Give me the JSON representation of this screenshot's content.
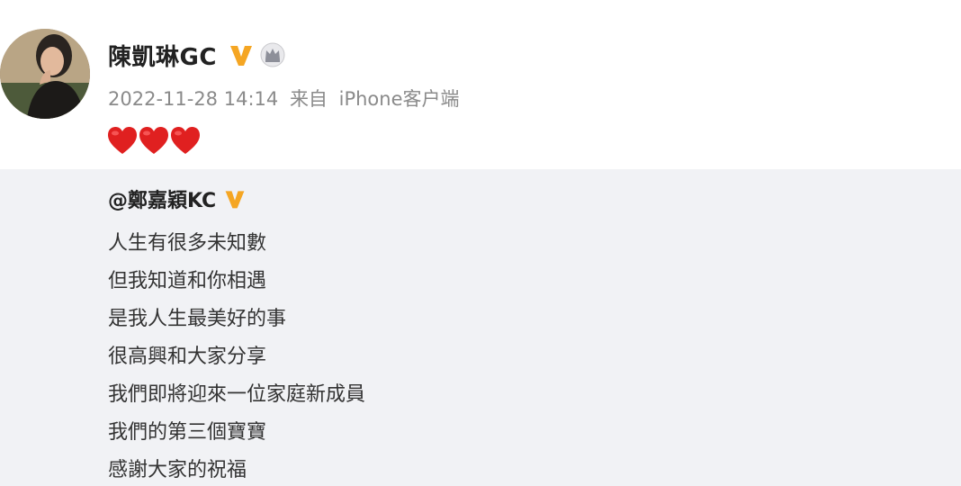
{
  "post": {
    "author": {
      "name": "陳凱琳GC",
      "verified_icon": "v-verified-badge",
      "member_icon": "crown-icon"
    },
    "timestamp": "2022-11-28 14:14",
    "source_label": "来自",
    "source_device": "iPhone客户端",
    "content_emoji": [
      "heart-emoji",
      "heart-emoji",
      "heart-emoji"
    ],
    "colors": {
      "badge_orange": "#f5a623",
      "heart_red": "#e02020",
      "repost_bg": "#f1f2f5",
      "meta_gray": "#8a8a8a"
    }
  },
  "repost": {
    "mention": "@鄭嘉穎KC",
    "verified_icon": "v-verified-badge",
    "lines": [
      "人生有很多未知數",
      "但我知道和你相遇",
      "是我人生最美好的事",
      "很高興和大家分享",
      "我們即將迎來一位家庭新成員",
      "我們的第三個寶寶",
      "感謝大家的祝福"
    ]
  }
}
